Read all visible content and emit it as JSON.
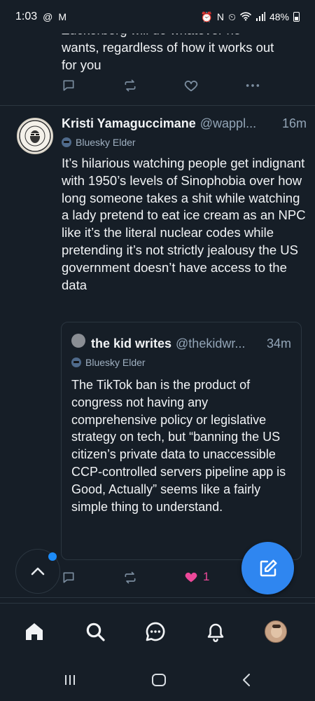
{
  "status_bar": {
    "time": "1:03",
    "battery": "48%",
    "left_icons": [
      "threads-icon",
      "gmail-icon"
    ],
    "right_icons": [
      "alarm-lock-icon",
      "nfc-icon",
      "alarm-icon",
      "wifi-icon",
      "signal-icon",
      "battery-icon"
    ]
  },
  "top_post": {
    "text": "Zuckerberg will do whatever he\nwants, regardless of how it works out\nfor you"
  },
  "post": {
    "display_name": "Kristi Yamaguccimane",
    "handle": "@wappl...",
    "time": "16m",
    "badge": "Bluesky Elder",
    "text": "It’s hilarious watching people get indignant with 1950’s levels of Sinophobia over how long someone takes a shit while watching a lady pretend to eat ice cream as an NPC like it’s the literal nuclear codes while pretending it’s not strictly jealousy the US government doesn’t have access to the data",
    "avatar_text": "PASS THE WILL PRAIRIE OIL · LET'S GET HER WRAPPED",
    "like_count": "1"
  },
  "quote": {
    "display_name": "the kid writes",
    "handle": "@thekidwr...",
    "time": "34m",
    "badge": "Bluesky Elder",
    "text": "The TikTok ban is the product of congress not having any comprehensive policy or legislative strategy on tech, but “banning the US citizen’s private data to unaccessible CCP-controlled servers pipeline app is Good, Actually” seems like a fairly simple thing to understand."
  },
  "tabs": [
    "home-icon",
    "search-icon",
    "chat-icon",
    "notifications-icon",
    "profile-avatar"
  ],
  "colors": {
    "background": "#161e27",
    "accent": "#2f86f0",
    "muted": "#7b8d9f",
    "like": "#ec4899"
  }
}
